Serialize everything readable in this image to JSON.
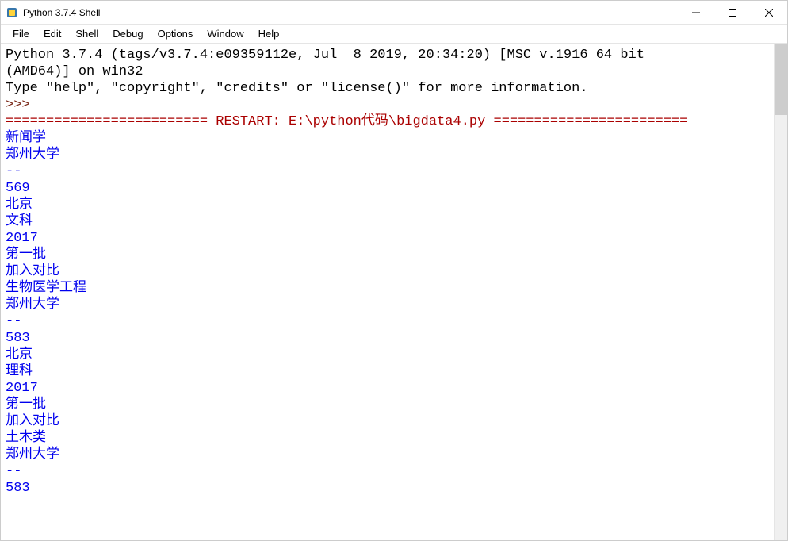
{
  "window": {
    "title": "Python 3.7.4 Shell"
  },
  "menu": {
    "file": "File",
    "edit": "Edit",
    "shell": "Shell",
    "debug": "Debug",
    "options": "Options",
    "window": "Window",
    "help": "Help"
  },
  "shell": {
    "header_line1": "Python 3.7.4 (tags/v3.7.4:e09359112e, Jul  8 2019, 20:34:20) [MSC v.1916 64 bit ",
    "header_line2": "(AMD64)] on win32",
    "header_line3": "Type \"help\", \"copyright\", \"credits\" or \"license()\" for more information.",
    "prompt": ">>> ",
    "restart_line": "========================= RESTART: E:\\python代码\\bigdata4.py ========================",
    "output": {
      "l01": "新闻学",
      "l02": "郑州大学",
      "l03": "--",
      "l04": "569",
      "l05": "北京",
      "l06": "文科",
      "l07": "2017",
      "l08": "第一批",
      "l09": "加入对比",
      "l10": "生物医学工程",
      "l11": "郑州大学",
      "l12": "--",
      "l13": "583",
      "l14": "北京",
      "l15": "理科",
      "l16": "2017",
      "l17": "第一批",
      "l18": "加入对比",
      "l19": "土木类",
      "l20": "郑州大学",
      "l21": "--",
      "l22": "583"
    }
  }
}
